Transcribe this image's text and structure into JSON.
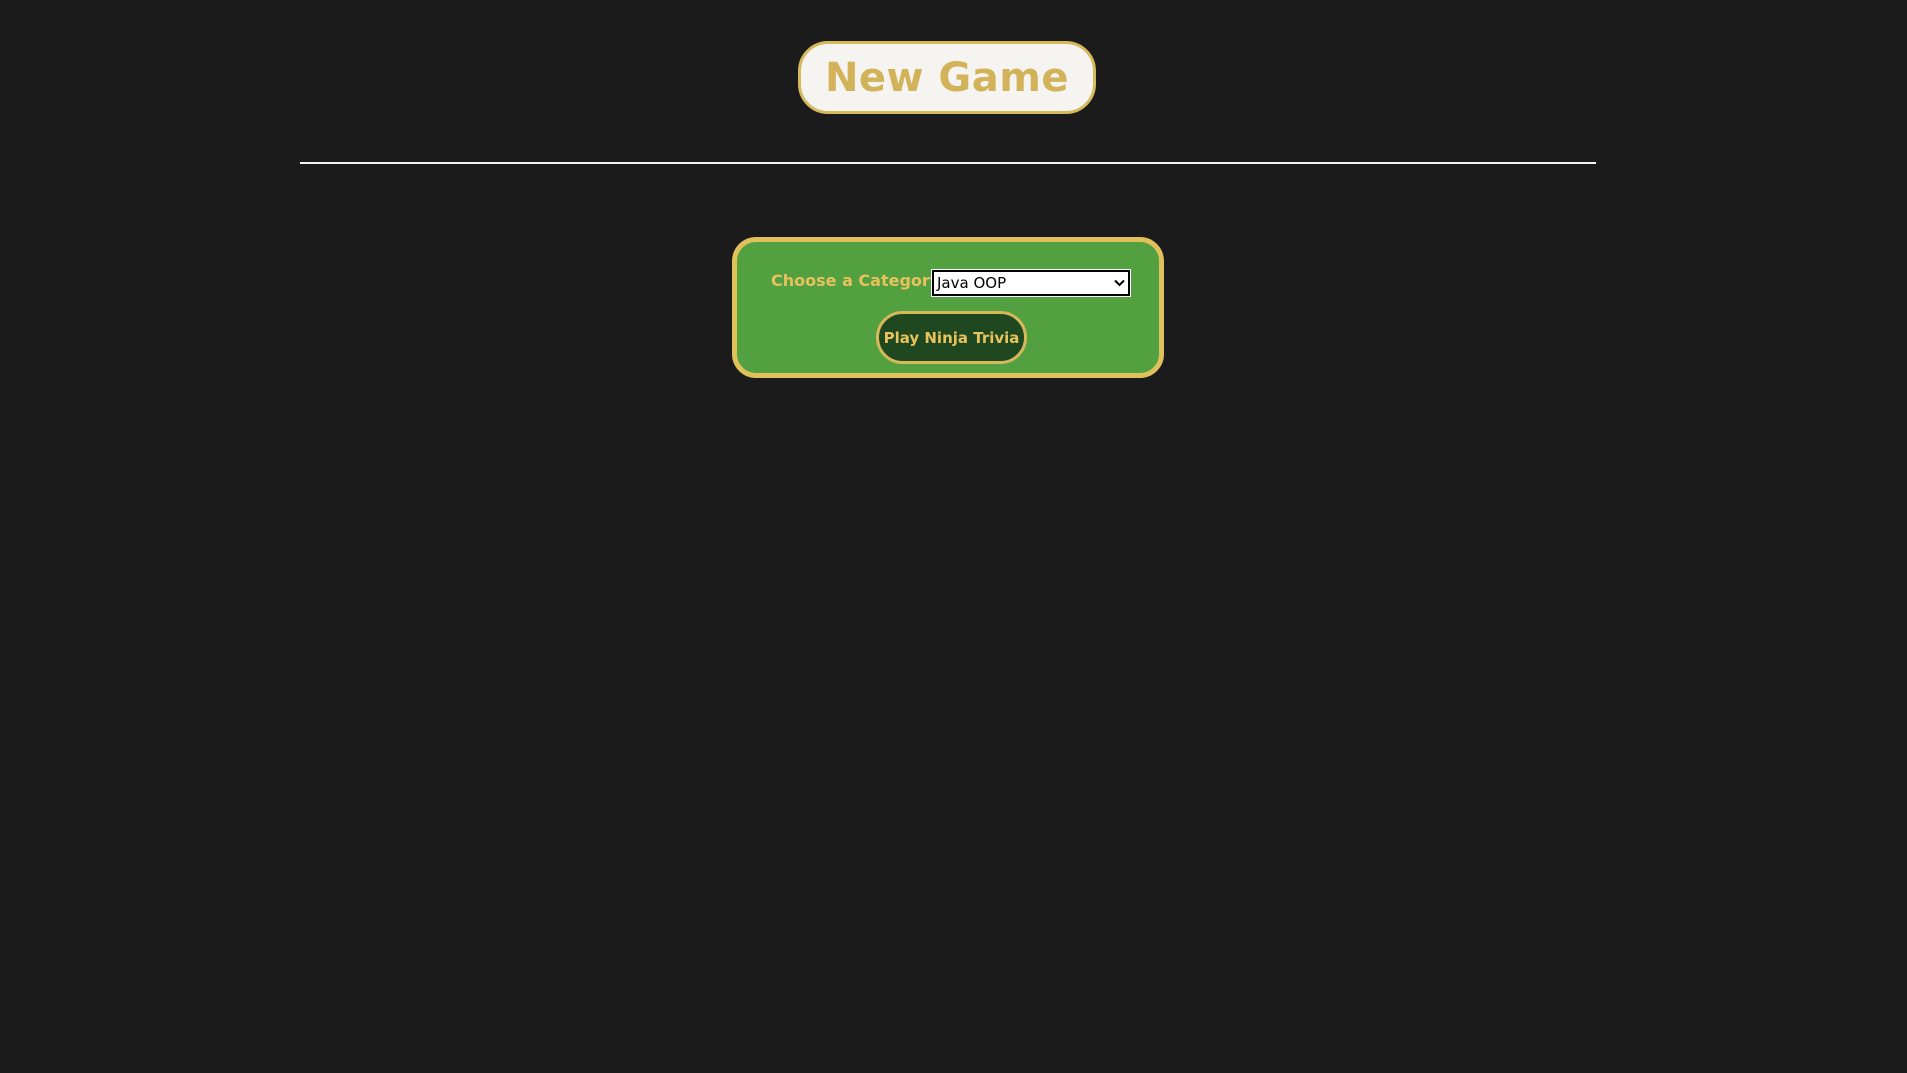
{
  "header": {
    "new_game_label": "New Game"
  },
  "form": {
    "category_label": "Choose a Category",
    "category_selected": "Java OOP",
    "play_button_label": "Play Ninja Trivia"
  },
  "icons": {
    "select_arrow": "chevron-down-icon"
  },
  "colors": {
    "background": "#1b1b1b",
    "gold_accent": "#d2b359",
    "panel_green": "#52a040",
    "button_dark_green": "#1f4820",
    "title_pill_bg": "#f6f4f0",
    "divider": "#f4f4f4"
  }
}
